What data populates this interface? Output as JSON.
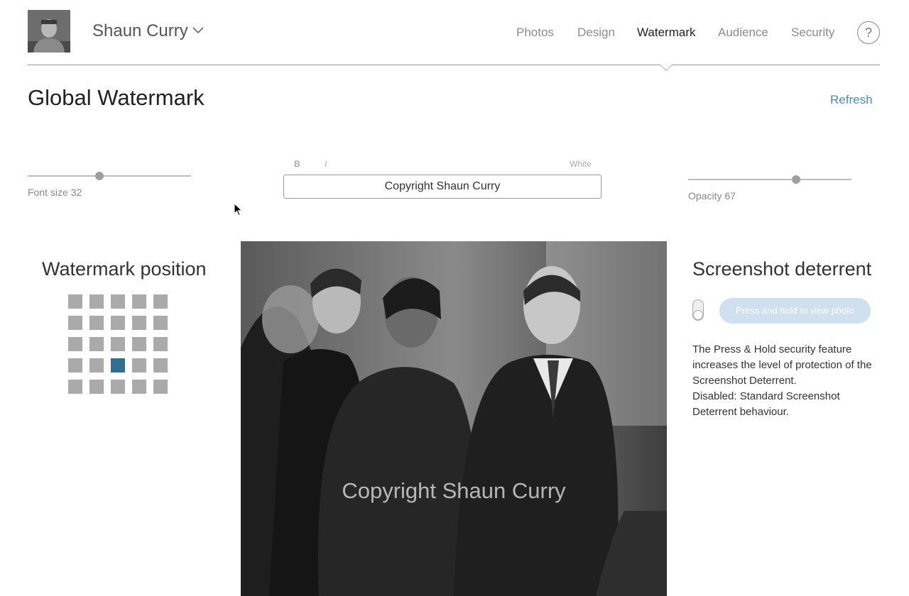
{
  "header": {
    "user_name": "Shaun Curry",
    "nav": [
      {
        "label": "Photos",
        "active": false
      },
      {
        "label": "Design",
        "active": false
      },
      {
        "label": "Watermark",
        "active": true
      },
      {
        "label": "Audience",
        "active": false
      },
      {
        "label": "Security",
        "active": false
      }
    ],
    "help_label": "?"
  },
  "page": {
    "title": "Global Watermark",
    "refresh_label": "Refresh"
  },
  "font_size": {
    "label": "Font size 32",
    "value": 32,
    "fraction": 0.44
  },
  "text_style": {
    "bold_label": "B",
    "italic_label": "I",
    "color_label": "White",
    "watermark_text": "Copyright Shaun Curry"
  },
  "opacity": {
    "label": "Opacity 67",
    "value": 67,
    "fraction": 0.66
  },
  "position": {
    "title": "Watermark position",
    "rows": 5,
    "cols": 5,
    "selected_row": 3,
    "selected_col": 2
  },
  "preview": {
    "watermark_text": "Copyright Shaun Curry"
  },
  "screenshot_deterrent": {
    "title": "Screenshot deterrent",
    "button_label": "Press and hold to view photo",
    "description_1": "The Press & Hold security feature increases the level of protection of the Screenshot Deterrent.",
    "description_2": "Disabled: Standard Screenshot Deterrent behaviour."
  },
  "colors": {
    "accent": "#4a8fb5",
    "selected_cell": "#2f6f8f",
    "button_disabled": "#cfe0ee"
  }
}
